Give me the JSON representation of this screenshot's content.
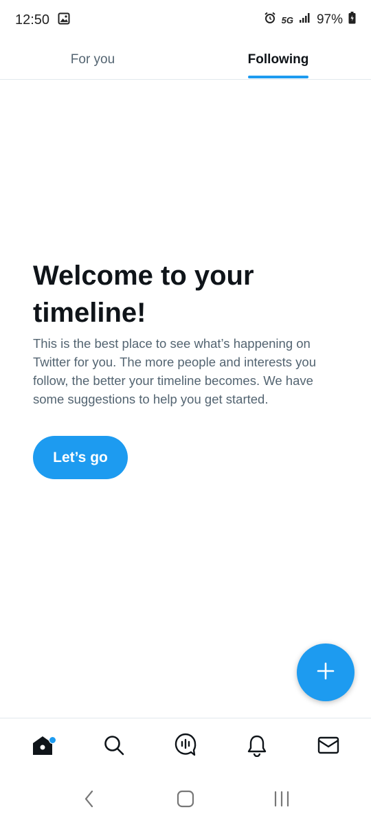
{
  "status_bar": {
    "time": "12:50",
    "network": "5G",
    "battery": "97%",
    "icons": [
      "image-icon",
      "alarm-icon",
      "signal-icon",
      "battery-icon"
    ]
  },
  "top_tabs": [
    {
      "label": "For you",
      "active": false
    },
    {
      "label": "Following",
      "active": true
    }
  ],
  "welcome": {
    "title": "Welcome to your timeline!",
    "body": "This is the best place to see what’s happening on Twitter for you. The more people and interests you follow, the better your timeline becomes. We have some suggestions to help you get started.",
    "button_label": "Let’s go"
  },
  "bottom_nav": {
    "items": [
      "home-icon",
      "search-icon",
      "spaces-icon",
      "notifications-icon",
      "messages-icon"
    ],
    "home_has_new": true
  },
  "colors": {
    "accent": "#1d9bf0",
    "text_primary": "#0f1419",
    "text_secondary": "#536471",
    "divider": "#e1e8ed"
  }
}
